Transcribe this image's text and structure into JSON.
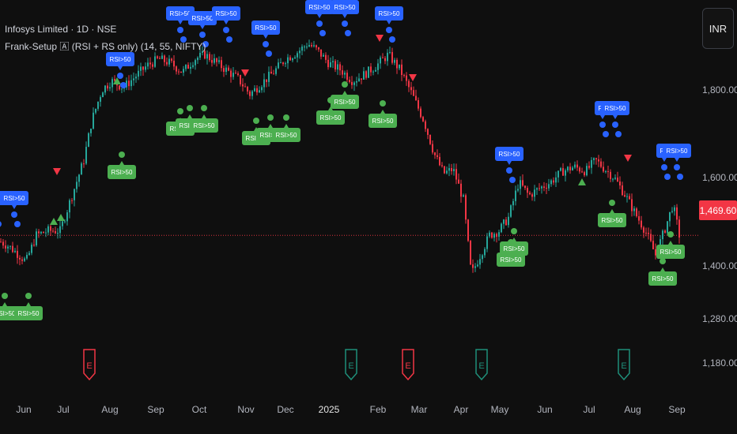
{
  "chart_data": {
    "type": "candlestick",
    "symbol_line": "Infosys Limited · 1D · NSE",
    "indicator_line": "Frank-Setup 🄰 (RSI + RS only) (14, 55, NIFTY)",
    "currency": "INR",
    "last_price": 1469.6,
    "last_price_label": "1,469.60",
    "yticks": [
      {
        "value": 1800,
        "label": "1,800.00"
      },
      {
        "value": 1600,
        "label": "1,600.00"
      },
      {
        "value": 1400,
        "label": "1,400.00"
      },
      {
        "value": 1280,
        "label": "1,280.00"
      },
      {
        "value": 1180,
        "label": "1,180.00"
      }
    ],
    "xticks": [
      "Jun",
      "Jul",
      "Aug",
      "Sep",
      "Oct",
      "Nov",
      "Dec",
      "2025",
      "Feb",
      "Mar",
      "Apr",
      "May",
      "Jun",
      "Jul",
      "Aug",
      "Sep"
    ],
    "price_path": [
      {
        "x": 0,
        "v": 1455
      },
      {
        "x": 10,
        "v": 1445
      },
      {
        "x": 20,
        "v": 1430
      },
      {
        "x": 32,
        "v": 1410
      },
      {
        "x": 45,
        "v": 1470
      },
      {
        "x": 60,
        "v": 1480
      },
      {
        "x": 75,
        "v": 1480
      },
      {
        "x": 90,
        "v": 1560
      },
      {
        "x": 105,
        "v": 1640
      },
      {
        "x": 115,
        "v": 1730
      },
      {
        "x": 128,
        "v": 1800
      },
      {
        "x": 140,
        "v": 1820
      },
      {
        "x": 155,
        "v": 1805
      },
      {
        "x": 170,
        "v": 1830
      },
      {
        "x": 185,
        "v": 1855
      },
      {
        "x": 200,
        "v": 1870
      },
      {
        "x": 215,
        "v": 1860
      },
      {
        "x": 230,
        "v": 1840
      },
      {
        "x": 245,
        "v": 1870
      },
      {
        "x": 258,
        "v": 1880
      },
      {
        "x": 270,
        "v": 1865
      },
      {
        "x": 285,
        "v": 1845
      },
      {
        "x": 300,
        "v": 1825
      },
      {
        "x": 315,
        "v": 1790
      },
      {
        "x": 330,
        "v": 1815
      },
      {
        "x": 345,
        "v": 1840
      },
      {
        "x": 360,
        "v": 1870
      },
      {
        "x": 375,
        "v": 1885
      },
      {
        "x": 388,
        "v": 1905
      },
      {
        "x": 400,
        "v": 1890
      },
      {
        "x": 415,
        "v": 1860
      },
      {
        "x": 430,
        "v": 1845
      },
      {
        "x": 445,
        "v": 1820
      },
      {
        "x": 460,
        "v": 1835
      },
      {
        "x": 475,
        "v": 1855
      },
      {
        "x": 490,
        "v": 1880
      },
      {
        "x": 505,
        "v": 1845
      },
      {
        "x": 520,
        "v": 1790
      },
      {
        "x": 535,
        "v": 1730
      },
      {
        "x": 548,
        "v": 1655
      },
      {
        "x": 560,
        "v": 1610
      },
      {
        "x": 572,
        "v": 1620
      },
      {
        "x": 585,
        "v": 1550
      },
      {
        "x": 595,
        "v": 1380
      },
      {
        "x": 605,
        "v": 1420
      },
      {
        "x": 618,
        "v": 1470
      },
      {
        "x": 630,
        "v": 1480
      },
      {
        "x": 642,
        "v": 1510
      },
      {
        "x": 655,
        "v": 1590
      },
      {
        "x": 668,
        "v": 1560
      },
      {
        "x": 680,
        "v": 1575
      },
      {
        "x": 695,
        "v": 1590
      },
      {
        "x": 710,
        "v": 1615
      },
      {
        "x": 725,
        "v": 1625
      },
      {
        "x": 740,
        "v": 1615
      },
      {
        "x": 752,
        "v": 1640
      },
      {
        "x": 764,
        "v": 1620
      },
      {
        "x": 776,
        "v": 1600
      },
      {
        "x": 790,
        "v": 1560
      },
      {
        "x": 802,
        "v": 1520
      },
      {
        "x": 815,
        "v": 1480
      },
      {
        "x": 828,
        "v": 1425
      },
      {
        "x": 840,
        "v": 1485
      },
      {
        "x": 850,
        "v": 1540
      },
      {
        "x": 858,
        "v": 1470
      }
    ],
    "rsi_labels": [
      {
        "text": "RSI>50",
        "x": -6,
        "y": 242
      },
      {
        "text": "RSI>50",
        "x": 18,
        "y": 242
      },
      {
        "text": "RSI>50",
        "x": 152,
        "y": 66
      },
      {
        "text": "RSI>50",
        "x": 228,
        "y": 8
      },
      {
        "text": "RSI>50",
        "x": 256,
        "y": 14
      },
      {
        "text": "RSI>50",
        "x": 286,
        "y": 8
      },
      {
        "text": "RSI>50",
        "x": 336,
        "y": 26
      },
      {
        "text": "RSI>50",
        "x": 404,
        "y": 0
      },
      {
        "text": "RSI>50",
        "x": 436,
        "y": 0
      },
      {
        "text": "RSI>50",
        "x": 492,
        "y": 8
      },
      {
        "text": "RSI>50",
        "x": 644,
        "y": 186
      },
      {
        "text": "RS",
        "x": 762,
        "y": 128
      },
      {
        "text": "RSI>50",
        "x": 778,
        "y": 128
      },
      {
        "text": "RS",
        "x": 840,
        "y": 182
      },
      {
        "text": "RSI>50",
        "x": 856,
        "y": 182
      }
    ],
    "rsi_green_labels": [
      {
        "text": "RSI>50",
        "x": 6,
        "y": 388
      },
      {
        "text": "RSI>50",
        "x": 36,
        "y": 388
      },
      {
        "text": "RSI>50",
        "x": 154,
        "y": 209
      },
      {
        "text": "RSI>50",
        "x": 228,
        "y": 154
      },
      {
        "text": "RSI>50",
        "x": 240,
        "y": 150
      },
      {
        "text": "RSI>50",
        "x": 258,
        "y": 150
      },
      {
        "text": "RSI>50",
        "x": 324,
        "y": 166
      },
      {
        "text": "RSI>50",
        "x": 342,
        "y": 162
      },
      {
        "text": "RSI>50",
        "x": 362,
        "y": 162
      },
      {
        "text": "RSI>50",
        "x": 418,
        "y": 140
      },
      {
        "text": "RSI>50",
        "x": 436,
        "y": 120
      },
      {
        "text": "RSI>50",
        "x": 484,
        "y": 144
      },
      {
        "text": "RSI>50",
        "x": 646,
        "y": 320
      },
      {
        "text": "RSI>50",
        "x": 650,
        "y": 306
      },
      {
        "text": "RSI>50",
        "x": 774,
        "y": 270
      },
      {
        "text": "RSI>50",
        "x": 838,
        "y": 344
      },
      {
        "text": "RSI>50",
        "x": 848,
        "y": 310
      }
    ],
    "short_labels": [
      {
        "text": "RSI>5",
        "x": 326,
        "y": 166,
        "color": "green"
      },
      {
        "text": "RSI>5",
        "x": 420,
        "y": 140,
        "color": "green"
      },
      {
        "text": "RSI>5",
        "x": 646,
        "y": 320,
        "color": "green"
      }
    ],
    "earnings_markers": [
      {
        "x": 113,
        "color": "#f23645"
      },
      {
        "x": 444,
        "color": "#1f8f7a"
      },
      {
        "x": 516,
        "color": "#f23645"
      },
      {
        "x": 609,
        "color": "#1f8f7a"
      },
      {
        "x": 789,
        "color": "#1f8f7a"
      }
    ],
    "earnings_letter": "E",
    "down_arrows": [
      {
        "x": 72,
        "y": 217
      },
      {
        "x": 310,
        "y": 92
      },
      {
        "x": 480,
        "y": 48
      },
      {
        "x": 522,
        "y": 98
      },
      {
        "x": 794,
        "y": 200
      }
    ],
    "up_arrows": [
      {
        "x": 68,
        "y": 281
      },
      {
        "x": 77,
        "y": 276
      },
      {
        "x": 148,
        "y": 103
      },
      {
        "x": 736,
        "y": 231
      }
    ],
    "colors": {
      "up": "#26a69a",
      "down": "#f23645",
      "rsi_blue": "#2962ff",
      "rsi_green": "#4caf50",
      "grid": "#1c1c1c"
    }
  }
}
